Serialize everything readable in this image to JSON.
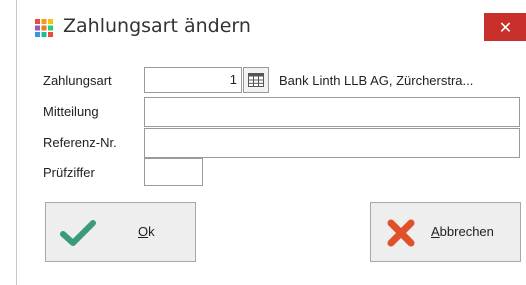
{
  "dialog": {
    "title": "Zahlungsart ändern",
    "close_label": "✕"
  },
  "form": {
    "zahlungsart_label": "Zahlungsart",
    "zahlungsart_value": "1",
    "zahlungsart_description": "Bank Linth LLB AG, Zürcherstra...",
    "mitteilung_label": "Mitteilung",
    "mitteilung_value": "",
    "referenz_label": "Referenz-Nr.",
    "referenz_value": "",
    "pruefziffer_label": "Prüfziffer",
    "pruefziffer_value": ""
  },
  "buttons": {
    "ok_label": "Ok",
    "ok_mnemonic": "O",
    "ok_rest": "k",
    "cancel_mnemonic": "A",
    "cancel_rest": "bbrechen",
    "cancel_label": "Abbrechen"
  },
  "icons": {
    "app": "grid-icon",
    "close": "close-icon",
    "lookup": "table-lookup-icon",
    "ok": "checkmark-icon",
    "cancel": "cross-icon"
  },
  "colors": {
    "close_bg": "#c9302c",
    "ok_icon": "#3c9a78",
    "cancel_icon": "#e0502a"
  }
}
